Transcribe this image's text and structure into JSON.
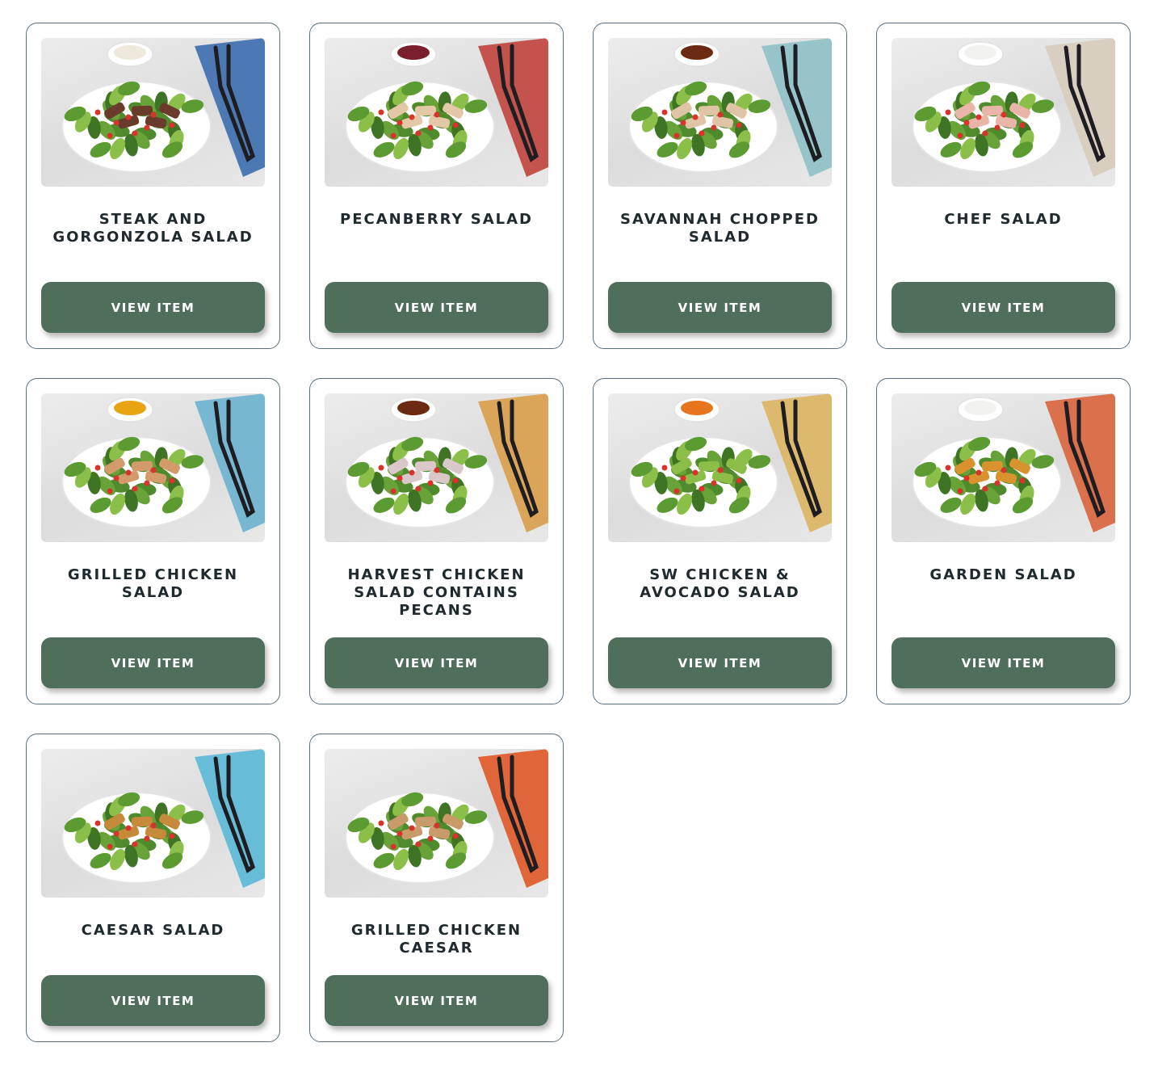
{
  "button_label": "VIEW ITEM",
  "colors": {
    "button_bg": "#4f6e5c",
    "card_border": "#5a6f7e",
    "title_text": "#1f2a2e"
  },
  "items": [
    {
      "name": "STEAK AND GORGONZOLA SALAD",
      "image": "steak-salad-photo",
      "dressing": "#efe9dc",
      "napkin": "#3f6fb0",
      "topping": "#6a3b2a"
    },
    {
      "name": "PECANBERRY SALAD",
      "image": "pecanberry-salad-photo",
      "dressing": "#7a1f2c",
      "napkin": "#c0463f",
      "topping": "#e4c7a6"
    },
    {
      "name": "SAVANNAH CHOPPED SALAD",
      "image": "savannah-salad-photo",
      "dressing": "#6b2a12",
      "napkin": "#8fc1c7",
      "topping": "#e0c4a6"
    },
    {
      "name": "CHEF SALAD",
      "image": "chef-salad-photo",
      "dressing": "#f2f2ee",
      "napkin": "#d8cdbd",
      "topping": "#e9b5a8"
    },
    {
      "name": "GRILLED CHICKEN SALAD",
      "image": "grilled-chicken-salad-photo",
      "dressing": "#e8a412",
      "napkin": "#6fb3d0",
      "topping": "#d39a6a"
    },
    {
      "name": "HARVEST CHICKEN SALAD CONTAINS PECANS",
      "image": "harvest-chicken-salad-photo",
      "dressing": "#6b2a12",
      "napkin": "#d9a04c",
      "topping": "#d9c7c9"
    },
    {
      "name": "SW CHICKEN & AVOCADO SALAD",
      "image": "sw-chicken-avocado-photo",
      "dressing": "#e8741e",
      "napkin": "#dcb564",
      "topping": "#8bbd48"
    },
    {
      "name": "GARDEN SALAD",
      "image": "garden-salad-photo",
      "dressing": "#f2f2ee",
      "napkin": "#d9663f",
      "topping": "#d8932e"
    },
    {
      "name": "CAESAR SALAD",
      "image": "caesar-salad-photo",
      "dressing": "",
      "napkin": "#5cb8d6",
      "topping": "#c78a3a"
    },
    {
      "name": "GRILLED CHICKEN CAESAR",
      "image": "grilled-chicken-caesar-photo",
      "dressing": "",
      "napkin": "#df5a2a",
      "topping": "#c99a6a"
    }
  ]
}
